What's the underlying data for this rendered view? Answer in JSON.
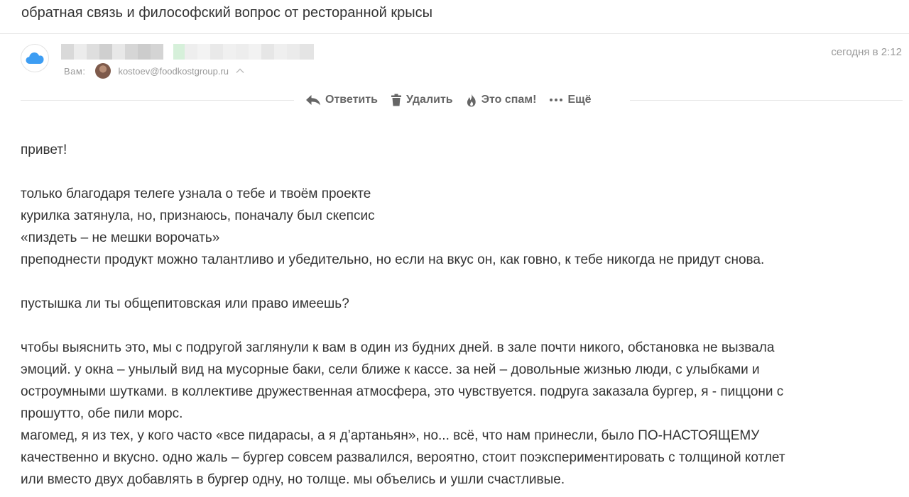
{
  "message": {
    "subject": "обратная связь и философский вопрос от ресторанной крысы",
    "date": "сегодня в 2:12",
    "to_label": "Вам:",
    "to_email": "kostoev@foodkostgroup.ru",
    "to_toggle_icon": "chevron-up-icon",
    "sender_avatar_icon": "icloud-icon"
  },
  "toolbar": {
    "reply_label": "Ответить",
    "delete_label": "Удалить",
    "spam_label": "Это спам!",
    "more_label": "Ещё"
  },
  "body": {
    "greeting": "привет!",
    "p1_line1": "только благодаря телеге узнала о тебе и твоём проекте",
    "p1_line2": "курилка затянула, но, признаюсь, поначалу был скепсис",
    "p1_line3": "«пиздеть – не мешки ворочать»",
    "p1_line4": "преподнести продукт можно талантливо и убедительно, но если на вкус он, как говно, к тебе никогда не придут снова.",
    "question": "пустышка ли ты общепитовская или право имеешь?",
    "p3_line1": "чтобы выяснить это, мы с подругой заглянули к вам в один из будних дней. в зале почти никого, обстановка не вызвала",
    "p3_line2": "эмоций. у окна – унылый вид на мусорные баки, сели ближе к кассе. за ней – довольные жизнью люди, с улыбками и",
    "p3_line3": "остроумными шутками. в коллективе дружественная атмосфера, это чувствуется. подруга заказала бургер, я - пиццони с",
    "p3_line4": "прошутто, обе пили морс.",
    "p4_line1": "магомед, я из тех, у кого часто «все пидарасы, а я д’артаньян», но... всё, что нам принесли, было ПО-НАСТОЯЩЕМУ",
    "p4_line2": "качественно и вкусно. одно жаль – бургер совсем развалился, вероятно, стоит поэкспериментировать с толщиной котлет",
    "p4_line3": "или вместо двух добавлять в бургер одну, но толще. мы объелись и ушли счастливые."
  },
  "colors": {
    "accent_cloud": "#3d9df3",
    "muted_text": "#999999",
    "toolbar_text": "#666666",
    "body_text": "#333333",
    "divider": "#e6e6e6"
  }
}
